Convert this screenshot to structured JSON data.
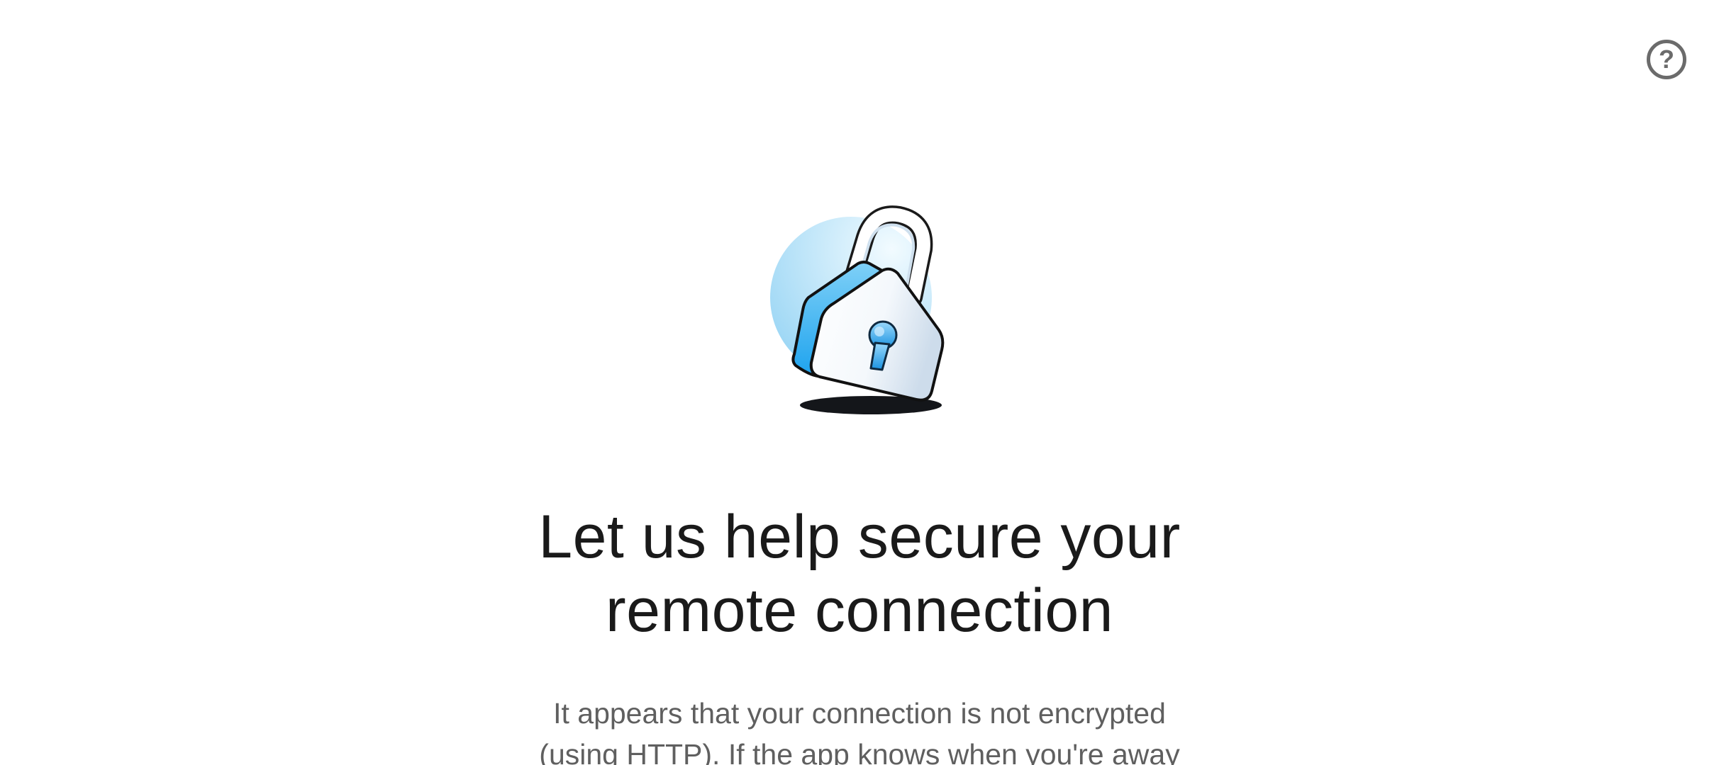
{
  "help": {
    "icon": "help-circle-icon",
    "glyph": "?",
    "color": "#6b6b6b"
  },
  "illustration": {
    "icon": "padlock-illustration",
    "accent_color": "#2aa8f0",
    "shadow_color": "#111111"
  },
  "main": {
    "headline_line1": "Let us help secure your",
    "headline_line2": "remote connection",
    "body_line1": "It appears that your connection is not encrypted",
    "body_line2": "(using HTTP). If the app knows when you're away"
  }
}
